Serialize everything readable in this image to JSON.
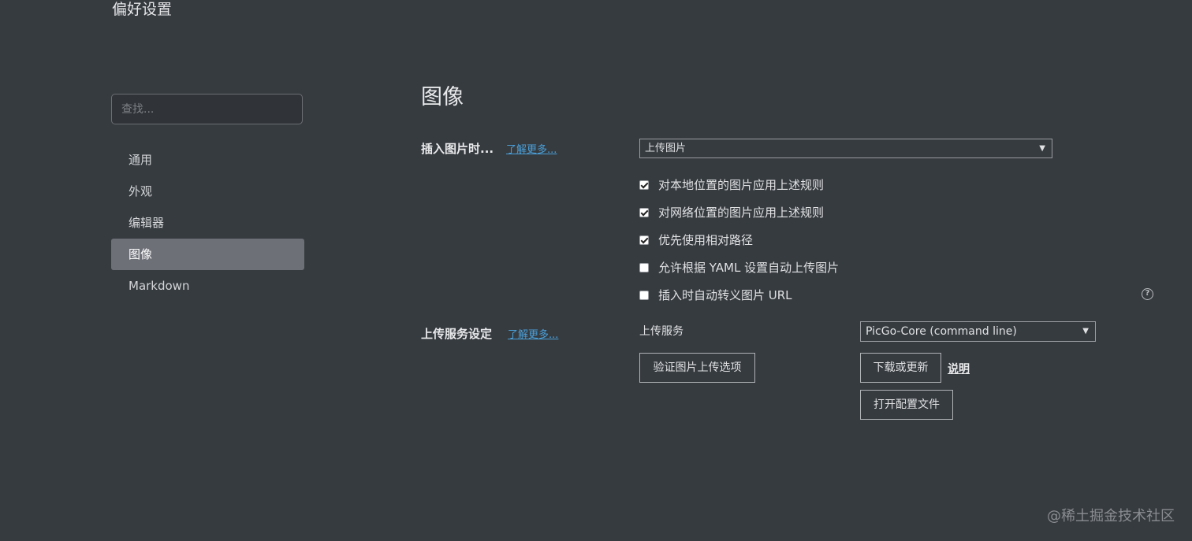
{
  "window": {
    "title": "偏好设置"
  },
  "search": {
    "placeholder": "查找..."
  },
  "sidebar": {
    "items": [
      {
        "label": "通用"
      },
      {
        "label": "外观"
      },
      {
        "label": "编辑器"
      },
      {
        "label": "图像"
      },
      {
        "label": "Markdown"
      }
    ],
    "active_index": 3
  },
  "main": {
    "title": "图像",
    "insert_image": {
      "label": "插入图片时...",
      "learn_more": "了解更多...",
      "action_select": {
        "value": "上传图片"
      },
      "options": [
        {
          "label": "对本地位置的图片应用上述规则",
          "checked": true
        },
        {
          "label": "对网络位置的图片应用上述规则",
          "checked": true
        },
        {
          "label": "优先使用相对路径",
          "checked": true
        },
        {
          "label": "允许根据 YAML 设置自动上传图片",
          "checked": false
        },
        {
          "label": "插入时自动转义图片 URL",
          "checked": false
        }
      ],
      "help_glyph": "?"
    },
    "upload_service": {
      "label": "上传服务设定",
      "learn_more": "了解更多...",
      "service_label": "上传服务",
      "service_select": {
        "value": "PicGo-Core (command line)"
      },
      "verify_button": "验证图片上传选项",
      "download_button": "下载或更新",
      "doc_link": "说明",
      "open_config_button": "打开配置文件"
    }
  },
  "watermark": "@稀土掘金技术社区",
  "glyphs": {
    "caret": "▼"
  }
}
